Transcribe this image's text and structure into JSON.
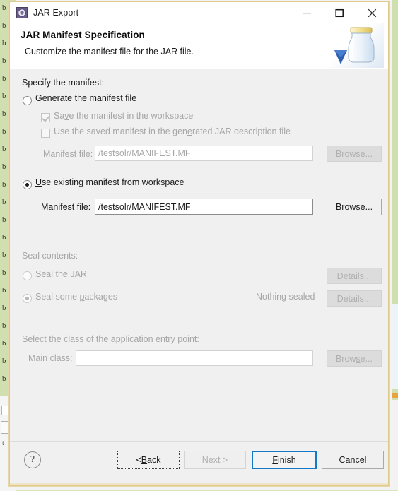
{
  "window": {
    "title": "JAR Export",
    "icon": "jar-export-icon",
    "controls": {
      "minimize": "—",
      "maximize": "□",
      "close": "✕"
    }
  },
  "banner": {
    "title": "JAR Manifest Specification",
    "subtitle": "Customize the manifest file for the JAR file.",
    "art_icon": "jar-with-arrow-icon"
  },
  "manifest_section": {
    "heading": "Specify the manifest:",
    "generate_radio": {
      "label": "Generate the manifest file",
      "mnemonic": "G",
      "selected": false,
      "enabled": true
    },
    "save_checkbox": {
      "label": "Save the manifest in the workspace",
      "checked": true,
      "enabled": false
    },
    "use_saved_checkbox": {
      "label": "Use the saved manifest in the generated JAR description file",
      "checked": false,
      "enabled": false
    },
    "generated_manifest_file": {
      "label": "Manifest file:",
      "value": "/testsolr/MANIFEST.MF",
      "placeholder": "",
      "enabled": false,
      "browse_label": "Browse..."
    },
    "existing_radio": {
      "label": "Use existing manifest from workspace",
      "mnemonic": "U",
      "selected": true,
      "enabled": true
    },
    "existing_manifest_file": {
      "label": "Manifest file:",
      "value": "/testsolr/MANIFEST.MF",
      "placeholder": "",
      "enabled": true,
      "browse_label": "Browse..."
    }
  },
  "seal_section": {
    "heading": "Seal contents:",
    "seal_jar_radio": {
      "label": "Seal the JAR",
      "selected": false,
      "enabled": false
    },
    "seal_jar_details": "Details...",
    "seal_packages_radio": {
      "label": "Seal some packages",
      "selected": true,
      "enabled": false
    },
    "seal_status": "Nothing sealed",
    "seal_packages_details": "Details..."
  },
  "entry_point_section": {
    "heading": "Select the class of the application entry point:",
    "main_class": {
      "label": "Main class:",
      "value": "",
      "placeholder": "",
      "enabled": false,
      "browse_label": "Browse..."
    }
  },
  "footer": {
    "help_icon": "?",
    "back": "< Back",
    "next": "Next >",
    "finish": "Finish",
    "cancel": "Cancel"
  },
  "colors": {
    "dialog_border": "#dfc98b",
    "default_button_focus": "#1479c8",
    "dialog_bg": "#f0f0f0",
    "disabled_text": "#a6a6a6"
  },
  "background": {
    "left_glyphs": [
      "b",
      "b",
      "b",
      "b",
      "b",
      "b",
      "b",
      "b",
      "b",
      "b",
      "b",
      "b",
      "b",
      "b",
      "b",
      "b",
      "b",
      "b",
      "b",
      "b",
      "b",
      "b"
    ],
    "lower_text": "t"
  }
}
